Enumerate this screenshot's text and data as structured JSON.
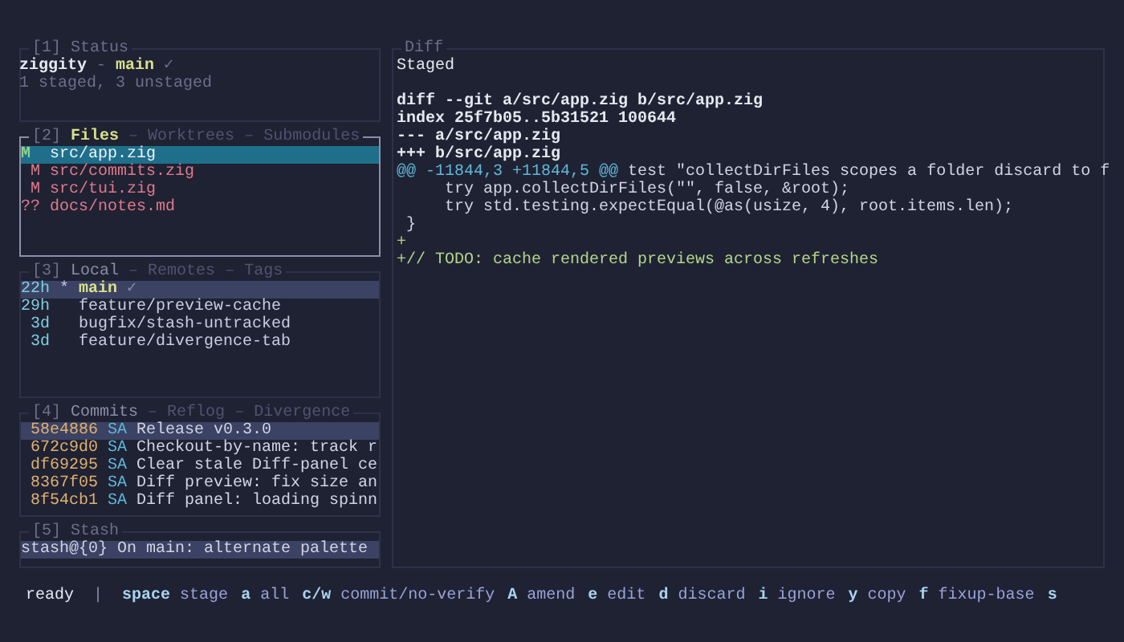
{
  "status_panel": {
    "number": "[1]",
    "title": "Status",
    "repo": "ziggity",
    "arrow": "-",
    "branch": "main",
    "check": "✓",
    "summary": "1 staged, 3 unstaged"
  },
  "files_panel": {
    "number": "[2]",
    "focused": true,
    "separator": "–",
    "tabs": [
      {
        "label": "Files",
        "selected": true
      },
      {
        "label": "Worktrees",
        "selected": false
      },
      {
        "label": "Submodules",
        "selected": false
      }
    ],
    "rows": [
      {
        "status": "M ",
        "kind": "staged",
        "path": "src/app.zig",
        "selected": true
      },
      {
        "status": " M",
        "kind": "unstaged",
        "path": "src/commits.zig",
        "selected": false
      },
      {
        "status": " M",
        "kind": "unstaged",
        "path": "src/tui.zig",
        "selected": false
      },
      {
        "status": "??",
        "kind": "untracked",
        "path": "docs/notes.md",
        "selected": false
      }
    ]
  },
  "branches_panel": {
    "number": "[3]",
    "focused": false,
    "separator": "–",
    "tabs": [
      {
        "label": "Local",
        "selected": true
      },
      {
        "label": "Remotes",
        "selected": false
      },
      {
        "label": "Tags",
        "selected": false
      }
    ],
    "rows": [
      {
        "age": "22h",
        "head": "*",
        "name": "main",
        "check": "✓",
        "current": true,
        "selected": true
      },
      {
        "age": "29h",
        "name": "feature/preview-cache",
        "current": false,
        "selected": false
      },
      {
        "age": "3d",
        "name": "bugfix/stash-untracked",
        "current": false,
        "selected": false
      },
      {
        "age": "3d",
        "name": "feature/divergence-tab",
        "current": false,
        "selected": false
      }
    ]
  },
  "commits_panel": {
    "number": "[4]",
    "focused": false,
    "separator": "–",
    "tabs": [
      {
        "label": "Commits",
        "selected": true
      },
      {
        "label": "Reflog",
        "selected": false
      },
      {
        "label": "Divergence",
        "selected": false
      }
    ],
    "rows": [
      {
        "hash": "58e4886",
        "author": "SA",
        "message": "Release v0.3.0",
        "selected": true
      },
      {
        "hash": "672c9d0",
        "author": "SA",
        "message": "Checkout-by-name: track r",
        "selected": false
      },
      {
        "hash": "df69295",
        "author": "SA",
        "message": "Clear stale Diff-panel ce",
        "selected": false
      },
      {
        "hash": "8367f05",
        "author": "SA",
        "message": "Diff preview: fix size an",
        "selected": false
      },
      {
        "hash": "8f54cb1",
        "author": "SA",
        "message": "Diff panel: loading spinn",
        "selected": false
      }
    ]
  },
  "stash_panel": {
    "number": "[5]",
    "title": "Stash",
    "rows": [
      {
        "text": "stash@{0} On main: alternate palette",
        "selected": true
      }
    ]
  },
  "diff_panel": {
    "title": "Diff",
    "section": "Staged",
    "lines": [
      {
        "kind": "blank"
      },
      {
        "kind": "header",
        "text": "diff --git a/src/app.zig b/src/app.zig"
      },
      {
        "kind": "header",
        "text": "index 25f7b05..5b31521 100644"
      },
      {
        "kind": "header",
        "text": "--- a/src/app.zig"
      },
      {
        "kind": "header",
        "text": "+++ b/src/app.zig"
      },
      {
        "kind": "hunk",
        "marker": "@@ -11844,3 +11844,5 @@",
        "text": " test \"collectDirFiles scopes a folder discard to f"
      },
      {
        "kind": "context",
        "text": "     try app.collectDirFiles(\"\", false, &root);"
      },
      {
        "kind": "context",
        "text": "     try std.testing.expectEqual(@as(usize, 4), root.items.len);"
      },
      {
        "kind": "context",
        "text": " }"
      },
      {
        "kind": "added",
        "text": "+"
      },
      {
        "kind": "added",
        "text": "+// TODO: cache rendered previews across refreshes"
      }
    ]
  },
  "status_bar": {
    "state": "ready",
    "separator": "|",
    "keys": [
      {
        "key": "space",
        "label": "stage"
      },
      {
        "key": "a",
        "label": "all"
      },
      {
        "key": "c/w",
        "label": "commit/no-verify"
      },
      {
        "key": "A",
        "label": "amend"
      },
      {
        "key": "e",
        "label": "edit"
      },
      {
        "key": "d",
        "label": "discard"
      },
      {
        "key": "i",
        "label": "ignore"
      },
      {
        "key": "y",
        "label": "copy"
      },
      {
        "key": "f",
        "label": "fixup-base"
      },
      {
        "key": "s"
      }
    ]
  }
}
